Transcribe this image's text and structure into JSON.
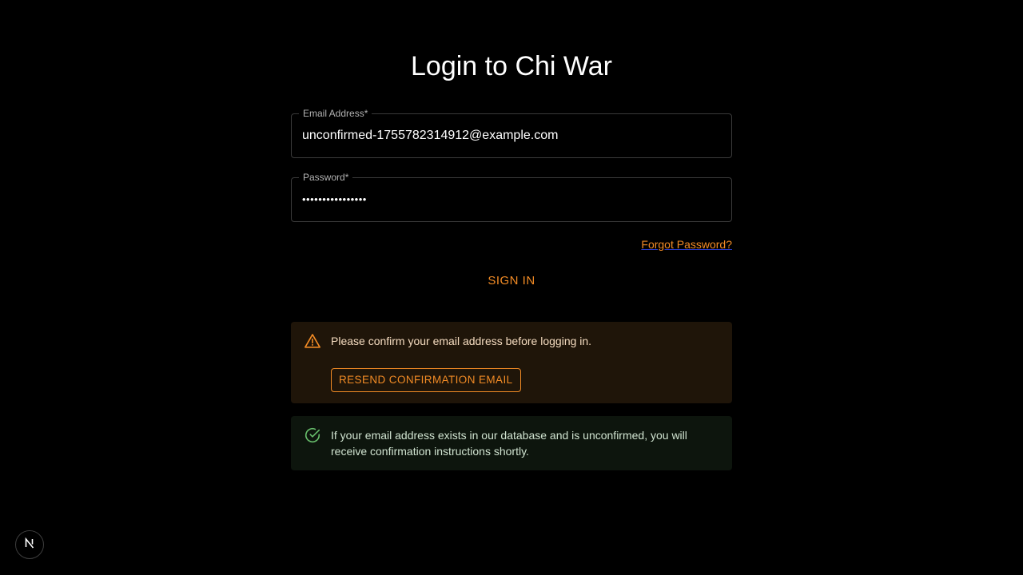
{
  "page": {
    "title": "Login to Chi War"
  },
  "form": {
    "email": {
      "label": "Email Address",
      "required_mark": "*",
      "value": "unconfirmed-1755782314912@example.com"
    },
    "password": {
      "label": "Password",
      "required_mark": "*",
      "masked_value": "••••••••••••••••"
    },
    "forgot_password_label": "Forgot Password?",
    "sign_in_label": "SIGN IN"
  },
  "alerts": {
    "warning": {
      "icon": "warning-triangle-icon",
      "message": "Please confirm your email address before logging in.",
      "resend_label": "RESEND CONFIRMATION EMAIL"
    },
    "success": {
      "icon": "check-circle-icon",
      "message": "If your email address exists in our database and is unconfirmed, you will receive confirmation instructions shortly."
    }
  },
  "dev_badge": {
    "icon": "nextjs-logo-icon",
    "letter": "N"
  },
  "colors": {
    "background": "#000000",
    "accent": "#f28b25",
    "warning_bg": "#1f1509",
    "success_bg": "#0d150d",
    "success_icon": "#66bb6a"
  }
}
